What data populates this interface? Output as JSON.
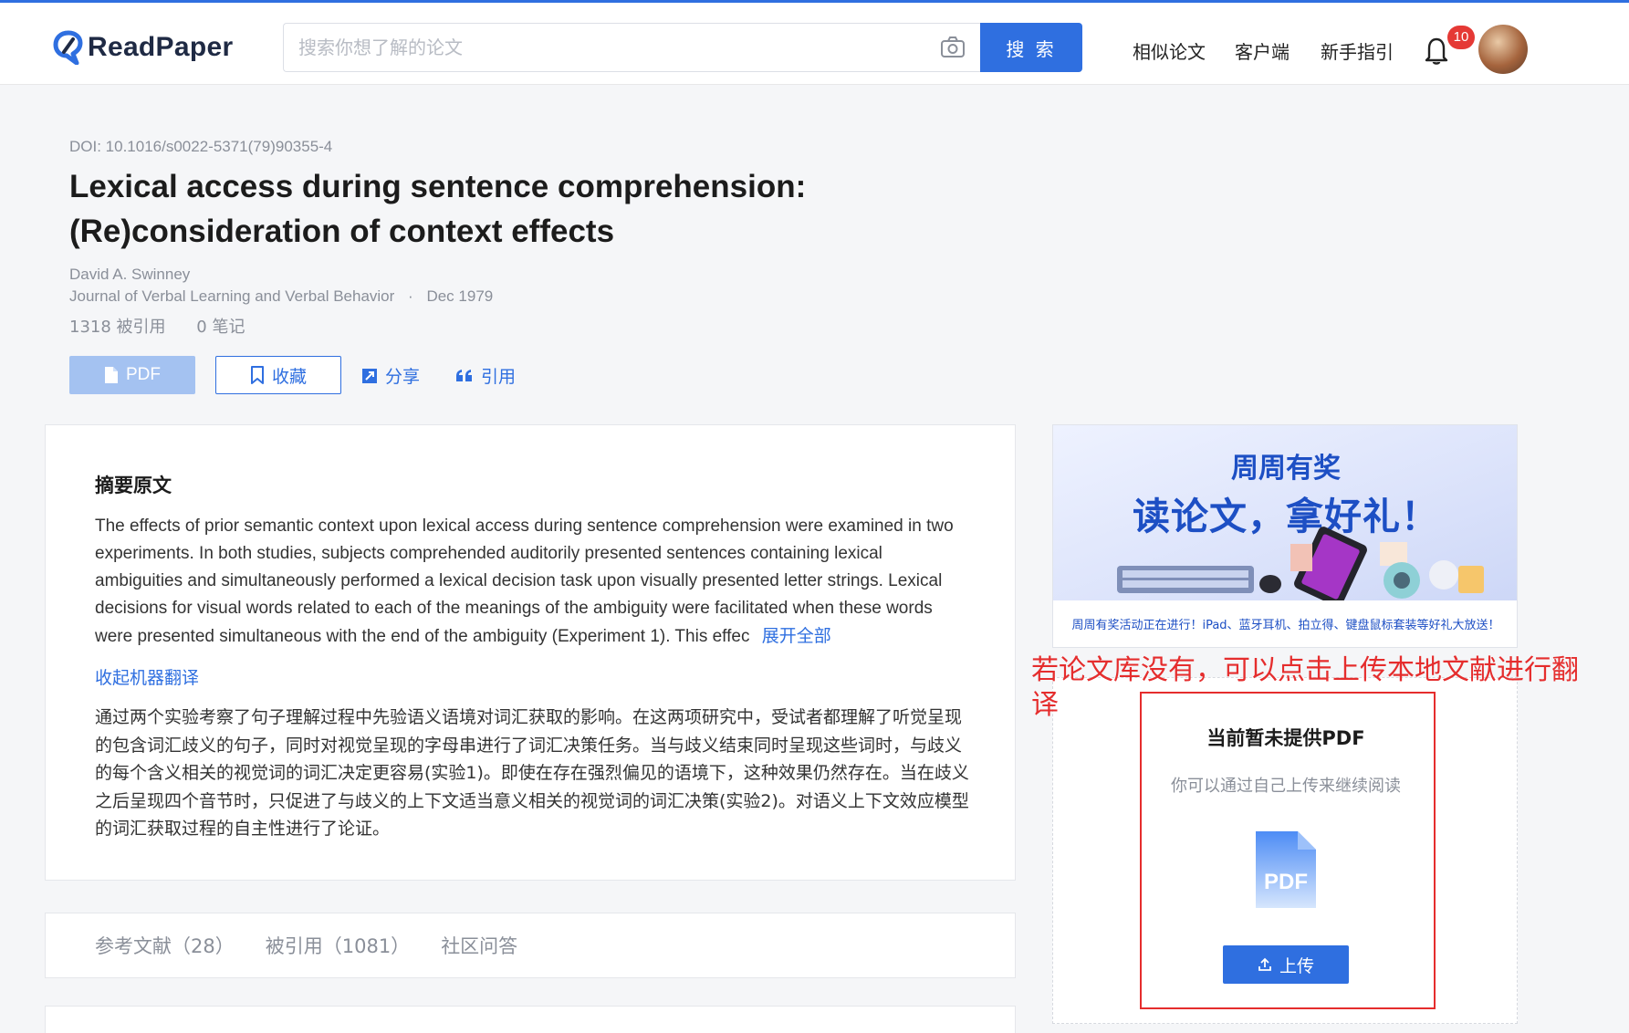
{
  "header": {
    "logo_text": "ReadPaper",
    "search_placeholder": "搜索你想了解的论文",
    "search_button": "搜 索",
    "nav": [
      "相似论文",
      "客户端",
      "新手指引"
    ],
    "notification_count": "10"
  },
  "paper": {
    "doi": "DOI: 10.1016/s0022-5371(79)90355-4",
    "title_line1": "Lexical access during sentence comprehension:",
    "title_line2": "(Re)consideration of context effects",
    "author": "David A. Swinney",
    "journal": "Journal of Verbal Learning and Verbal Behavior",
    "separator": "·",
    "date": "Dec 1979",
    "citations": "1318 被引用",
    "notes": "0 笔记"
  },
  "actions": {
    "pdf": "PDF",
    "favorite": "收藏",
    "share": "分享",
    "cite": "引用"
  },
  "abstract": {
    "heading": "摘要原文",
    "text": "The effects of prior semantic context upon lexical access during sentence comprehension were examined in two experiments. In both studies, subjects comprehended auditorily presented sentences containing lexical ambiguities and simultaneously performed a lexical decision task upon visually presented letter strings. Lexical decisions for visual words related to each of the meanings of the ambiguity were facilitated when these words were presented simultaneous with the end of the ambiguity (Experiment 1). This effec",
    "expand": "展开全部",
    "collapse_translation": "收起机器翻译",
    "translation": "通过两个实验考察了句子理解过程中先验语义语境对词汇获取的影响。在这两项研究中，受试者都理解了听觉呈现的包含词汇歧义的句子，同时对视觉呈现的字母串进行了词汇决策任务。当与歧义结束同时呈现这些词时，与歧义的每个含义相关的视觉词的词汇决定更容易(实验1)。即使在存在强烈偏见的语境下，这种效果仍然存在。当在歧义之后呈现四个音节时，只促进了与歧义的上下文适当意义相关的视觉词的词汇决策(实验2)。对语义上下文效应模型的词汇获取过程的自主性进行了论证。"
  },
  "tabs": [
    "参考文献（28）",
    "被引用（1081）",
    "社区问答"
  ],
  "banner": {
    "line1": "周周有奖",
    "line2": "读论文，拿好礼！",
    "footer": "周周有奖活动正在进行！iPad、蓝牙耳机、拍立得、键盘鼠标套装等好礼大放送！"
  },
  "annotation": "若论文库没有，可以点击上传本地文献进行翻译",
  "upload": {
    "title": "当前暂未提供PDF",
    "subtitle": "你可以通过自己上传来继续阅读",
    "pdf_label": "PDF",
    "button": "上传"
  },
  "colors": {
    "accent": "#2f6fe0",
    "annotation_red": "#e52d2d"
  }
}
